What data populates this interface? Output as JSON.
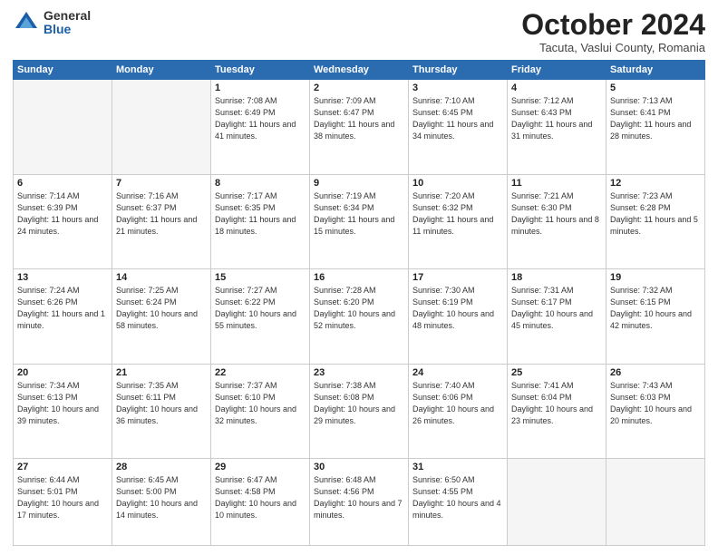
{
  "header": {
    "logo_general": "General",
    "logo_blue": "Blue",
    "month_title": "October 2024",
    "subtitle": "Tacuta, Vaslui County, Romania"
  },
  "weekdays": [
    "Sunday",
    "Monday",
    "Tuesday",
    "Wednesday",
    "Thursday",
    "Friday",
    "Saturday"
  ],
  "weeks": [
    [
      {
        "day": "",
        "info": ""
      },
      {
        "day": "",
        "info": ""
      },
      {
        "day": "1",
        "info": "Sunrise: 7:08 AM\nSunset: 6:49 PM\nDaylight: 11 hours and 41 minutes."
      },
      {
        "day": "2",
        "info": "Sunrise: 7:09 AM\nSunset: 6:47 PM\nDaylight: 11 hours and 38 minutes."
      },
      {
        "day": "3",
        "info": "Sunrise: 7:10 AM\nSunset: 6:45 PM\nDaylight: 11 hours and 34 minutes."
      },
      {
        "day": "4",
        "info": "Sunrise: 7:12 AM\nSunset: 6:43 PM\nDaylight: 11 hours and 31 minutes."
      },
      {
        "day": "5",
        "info": "Sunrise: 7:13 AM\nSunset: 6:41 PM\nDaylight: 11 hours and 28 minutes."
      }
    ],
    [
      {
        "day": "6",
        "info": "Sunrise: 7:14 AM\nSunset: 6:39 PM\nDaylight: 11 hours and 24 minutes."
      },
      {
        "day": "7",
        "info": "Sunrise: 7:16 AM\nSunset: 6:37 PM\nDaylight: 11 hours and 21 minutes."
      },
      {
        "day": "8",
        "info": "Sunrise: 7:17 AM\nSunset: 6:35 PM\nDaylight: 11 hours and 18 minutes."
      },
      {
        "day": "9",
        "info": "Sunrise: 7:19 AM\nSunset: 6:34 PM\nDaylight: 11 hours and 15 minutes."
      },
      {
        "day": "10",
        "info": "Sunrise: 7:20 AM\nSunset: 6:32 PM\nDaylight: 11 hours and 11 minutes."
      },
      {
        "day": "11",
        "info": "Sunrise: 7:21 AM\nSunset: 6:30 PM\nDaylight: 11 hours and 8 minutes."
      },
      {
        "day": "12",
        "info": "Sunrise: 7:23 AM\nSunset: 6:28 PM\nDaylight: 11 hours and 5 minutes."
      }
    ],
    [
      {
        "day": "13",
        "info": "Sunrise: 7:24 AM\nSunset: 6:26 PM\nDaylight: 11 hours and 1 minute."
      },
      {
        "day": "14",
        "info": "Sunrise: 7:25 AM\nSunset: 6:24 PM\nDaylight: 10 hours and 58 minutes."
      },
      {
        "day": "15",
        "info": "Sunrise: 7:27 AM\nSunset: 6:22 PM\nDaylight: 10 hours and 55 minutes."
      },
      {
        "day": "16",
        "info": "Sunrise: 7:28 AM\nSunset: 6:20 PM\nDaylight: 10 hours and 52 minutes."
      },
      {
        "day": "17",
        "info": "Sunrise: 7:30 AM\nSunset: 6:19 PM\nDaylight: 10 hours and 48 minutes."
      },
      {
        "day": "18",
        "info": "Sunrise: 7:31 AM\nSunset: 6:17 PM\nDaylight: 10 hours and 45 minutes."
      },
      {
        "day": "19",
        "info": "Sunrise: 7:32 AM\nSunset: 6:15 PM\nDaylight: 10 hours and 42 minutes."
      }
    ],
    [
      {
        "day": "20",
        "info": "Sunrise: 7:34 AM\nSunset: 6:13 PM\nDaylight: 10 hours and 39 minutes."
      },
      {
        "day": "21",
        "info": "Sunrise: 7:35 AM\nSunset: 6:11 PM\nDaylight: 10 hours and 36 minutes."
      },
      {
        "day": "22",
        "info": "Sunrise: 7:37 AM\nSunset: 6:10 PM\nDaylight: 10 hours and 32 minutes."
      },
      {
        "day": "23",
        "info": "Sunrise: 7:38 AM\nSunset: 6:08 PM\nDaylight: 10 hours and 29 minutes."
      },
      {
        "day": "24",
        "info": "Sunrise: 7:40 AM\nSunset: 6:06 PM\nDaylight: 10 hours and 26 minutes."
      },
      {
        "day": "25",
        "info": "Sunrise: 7:41 AM\nSunset: 6:04 PM\nDaylight: 10 hours and 23 minutes."
      },
      {
        "day": "26",
        "info": "Sunrise: 7:43 AM\nSunset: 6:03 PM\nDaylight: 10 hours and 20 minutes."
      }
    ],
    [
      {
        "day": "27",
        "info": "Sunrise: 6:44 AM\nSunset: 5:01 PM\nDaylight: 10 hours and 17 minutes."
      },
      {
        "day": "28",
        "info": "Sunrise: 6:45 AM\nSunset: 5:00 PM\nDaylight: 10 hours and 14 minutes."
      },
      {
        "day": "29",
        "info": "Sunrise: 6:47 AM\nSunset: 4:58 PM\nDaylight: 10 hours and 10 minutes."
      },
      {
        "day": "30",
        "info": "Sunrise: 6:48 AM\nSunset: 4:56 PM\nDaylight: 10 hours and 7 minutes."
      },
      {
        "day": "31",
        "info": "Sunrise: 6:50 AM\nSunset: 4:55 PM\nDaylight: 10 hours and 4 minutes."
      },
      {
        "day": "",
        "info": ""
      },
      {
        "day": "",
        "info": ""
      }
    ]
  ]
}
